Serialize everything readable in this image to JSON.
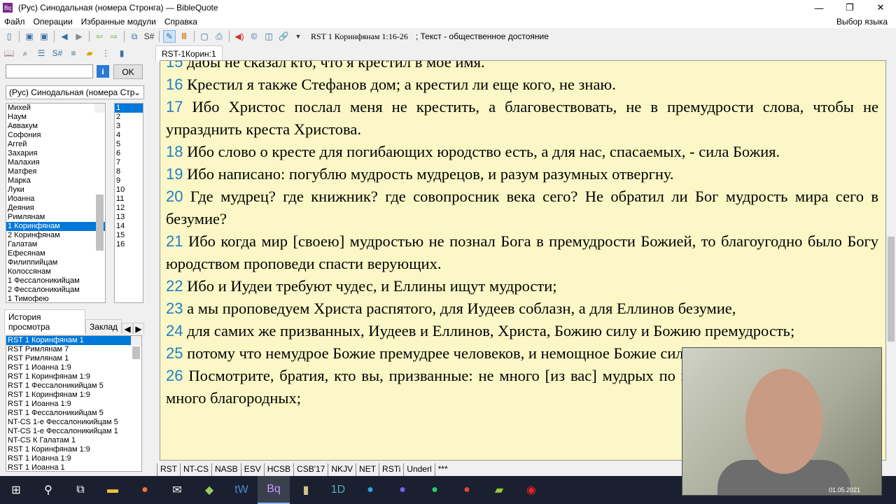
{
  "window": {
    "title": "(Рус) Синодальная (номера Стронга) — BibleQuote",
    "icon_text": "Bq"
  },
  "menu": [
    "Файл",
    "Операции",
    "Избранные модули",
    "Справка"
  ],
  "language_label": "Выбор языка",
  "toolbar": {
    "reference": "RST 1 Коринфянам 1:16-26",
    "copyright": "; Текст - общественное достояние"
  },
  "search": {
    "value": "",
    "ok_label": "OK",
    "info_label": "i"
  },
  "module_select": "(Рус) Синодальная (номера Стр",
  "books": [
    "Михей",
    "Наум",
    "Аввакум",
    "Софония",
    "Аггей",
    "Захария",
    "Малахия",
    "Матфея",
    "Марка",
    "Луки",
    "Иоанна",
    "Деяния",
    "Римлянам",
    "1 Коринфянам",
    "2 Коринфянам",
    "Галатам",
    "Ефесянам",
    "Филиппийцам",
    "Колоссянам",
    "1 Фессалоникийцам",
    "2 Фессалоникийцам",
    "1 Тимофею"
  ],
  "selected_book": "1 Коринфянам",
  "chapters": [
    "1",
    "2",
    "3",
    "4",
    "5",
    "6",
    "7",
    "8",
    "9",
    "10",
    "11",
    "12",
    "13",
    "14",
    "15",
    "16"
  ],
  "selected_chapter": "1",
  "history_tabs": [
    "История просмотра",
    "Заклад"
  ],
  "history": [
    "RST 1 Коринфянам 1",
    "RST Римлянам 7",
    "RST Римлянам 1",
    "RST 1 Иоанна 1:9",
    "RST 1 Коринфянам 1:9",
    "RST 1 Фессалоникийцам 5",
    "RST 1 Коринфянам 1:9",
    "RST 1 Иоанна 1:9",
    "RST 1 Фессалоникийцам 5",
    "NT-CS 1-е Фессалоникийцам 5",
    "NT-CS 1-е Фессалоникийцам 1",
    "NT-CS К Галатам 1",
    "RST 1 Коринфянам 1:9",
    "RST 1 Иоанна 1:9",
    "RST 1 Иоанна 1"
  ],
  "doc_tab": "RST-1Корин:1",
  "verses": [
    {
      "n": "15",
      "t": "дабы не сказал кто, что я крестил в мое имя."
    },
    {
      "n": "16",
      "t": "Крестил я также Стефанов дом; а крестил ли еще кого, не знаю."
    },
    {
      "n": "17",
      "t": "Ибо Христос послал меня не крестить, а благовествовать, не в премудрости слова, чтобы не упразднить креста Христова."
    },
    {
      "n": "18",
      "t": "Ибо слово о кресте для погибающих юродство есть, а для нас, спасаемых, - сила Божия."
    },
    {
      "n": "19",
      "t": "Ибо написано: погублю мудрость мудрецов, и разум разумных отвергну."
    },
    {
      "n": "20",
      "t": "Где мудрец? где книжник? где совопросник века сего? Не обратил ли Бог мудрость мира сего в безумие?"
    },
    {
      "n": "21",
      "t": "Ибо когда мир [своею] мудростью не познал Бога в премудрости Божией, то благоугодно было Богу юродством проповеди спасти верующих."
    },
    {
      "n": "22",
      "t": "Ибо и Иудеи требуют чудес, и Еллины ищут мудрости;"
    },
    {
      "n": "23",
      "t": "а мы проповедуем Христа распятого, для Иудеев соблазн, а для Еллинов безумие,"
    },
    {
      "n": "24",
      "t": "для самих же призванных, Иудеев и Еллинов, Христа, Божию силу и Божию премудрость;"
    },
    {
      "n": "25",
      "t": "потому что немудрое Божие премудрее человеков, и немощное Божие сильнее человеков."
    },
    {
      "n": "26",
      "t": "Посмотрите, братия, кто вы, призванные: не много [из вас] мудрых по плоти, не много сильных, не много благородных;"
    }
  ],
  "module_tabs": [
    "RST",
    "NT-CS",
    "NASB",
    "ESV",
    "HCSB",
    "CSB'17",
    "NKJV",
    "NET",
    "RSTi",
    "Underl",
    "***"
  ],
  "webcam_date": "01.05.2021"
}
